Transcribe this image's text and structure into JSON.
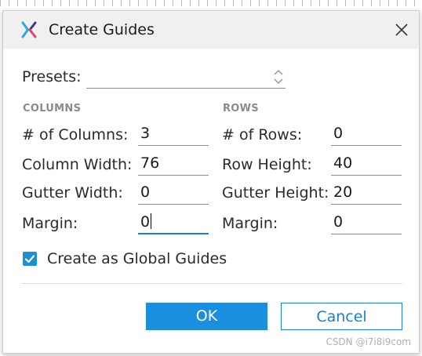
{
  "dialog": {
    "title": "Create Guides",
    "icon": "x-logo-icon"
  },
  "presets": {
    "label": "Presets:",
    "value": ""
  },
  "columns": {
    "section_label": "COLUMNS",
    "count_label": "# of Columns:",
    "count_value": "3",
    "width_label": "Column Width:",
    "width_value": "76",
    "gutter_label": "Gutter Width:",
    "gutter_value": "0",
    "margin_label": "Margin:",
    "margin_value": "0"
  },
  "rows": {
    "section_label": "ROWS",
    "count_label": "# of Rows:",
    "count_value": "0",
    "height_label": "Row Height:",
    "height_value": "40",
    "gutter_label": "Gutter Height:",
    "gutter_value": "20",
    "margin_label": "Margin:",
    "margin_value": "0"
  },
  "global_guides": {
    "label": "Create as Global Guides",
    "checked": true
  },
  "buttons": {
    "ok": "OK",
    "cancel": "Cancel"
  },
  "watermark": "CSDN @i7i8i9com",
  "colors": {
    "accent": "#1a8fde",
    "titlebar": "#f0f0f0"
  }
}
